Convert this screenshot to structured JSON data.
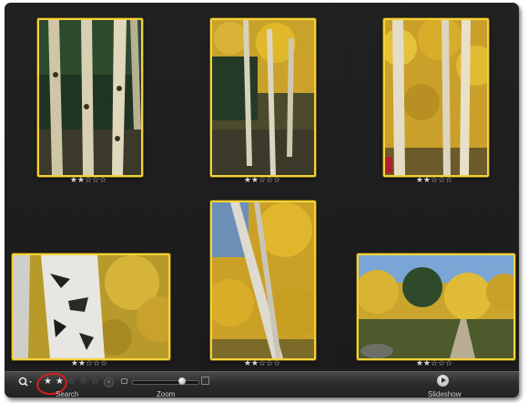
{
  "photos": [
    {
      "stars": "★★☆☆☆",
      "rating": 2
    },
    {
      "stars": "★★☆☆☆",
      "rating": 2
    },
    {
      "stars": "★★☆☆☆",
      "rating": 2
    },
    {
      "stars": "★★☆☆☆",
      "rating": 2
    },
    {
      "stars": "★★☆☆☆",
      "rating": 2
    },
    {
      "stars": "★★☆☆☆",
      "rating": 2
    }
  ],
  "toolbar": {
    "search_label": "Search",
    "zoom_label": "Zoom",
    "slideshow_label": "Slideshow",
    "star_filled": "★",
    "star_empty": "☆",
    "search_rating": 2,
    "clear_glyph": "×",
    "zoom_level": 0.8
  },
  "colors": {
    "selection_border": "#f4d23a",
    "annotation_circle": "#d41f1f",
    "background": "#1d1d1d"
  }
}
